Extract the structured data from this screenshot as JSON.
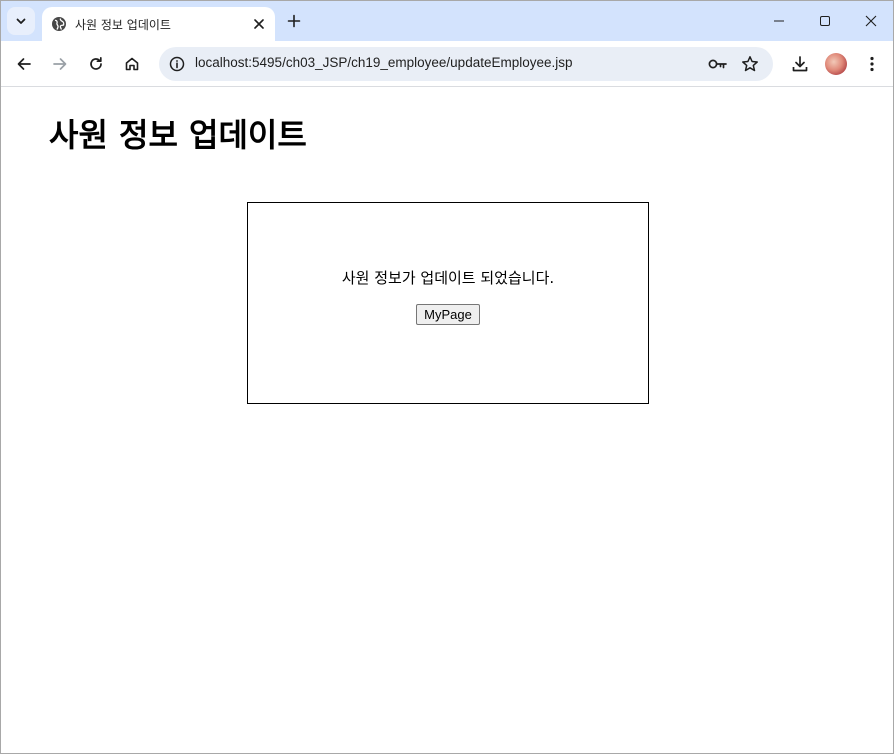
{
  "browser": {
    "tab": {
      "title": "사원 정보 업데이트",
      "favicon": "globe-icon"
    },
    "address_bar": {
      "url": "localhost:5495/ch03_JSP/ch19_employee/updateEmployee.jsp"
    },
    "icons": {
      "tab_search": "chevron-down-icon",
      "new_tab": "plus-icon",
      "minimize": "minimize-icon",
      "maximize": "maximize-icon",
      "close": "close-icon",
      "back": "back-arrow-icon",
      "forward": "forward-arrow-icon",
      "reload": "reload-icon",
      "home": "home-icon",
      "site_info": "info-icon",
      "password_key": "key-icon",
      "bookmark": "star-icon",
      "download": "download-icon",
      "profile": "avatar",
      "menu": "kebab-menu-icon"
    },
    "colors": {
      "tabstrip_bg": "#d3e3fd",
      "omnibox_bg": "#e9eef6"
    }
  },
  "page": {
    "title": "사원 정보 업데이트",
    "message": "사원 정보가 업데이트 되었습니다.",
    "mypage_button": "MyPage"
  }
}
